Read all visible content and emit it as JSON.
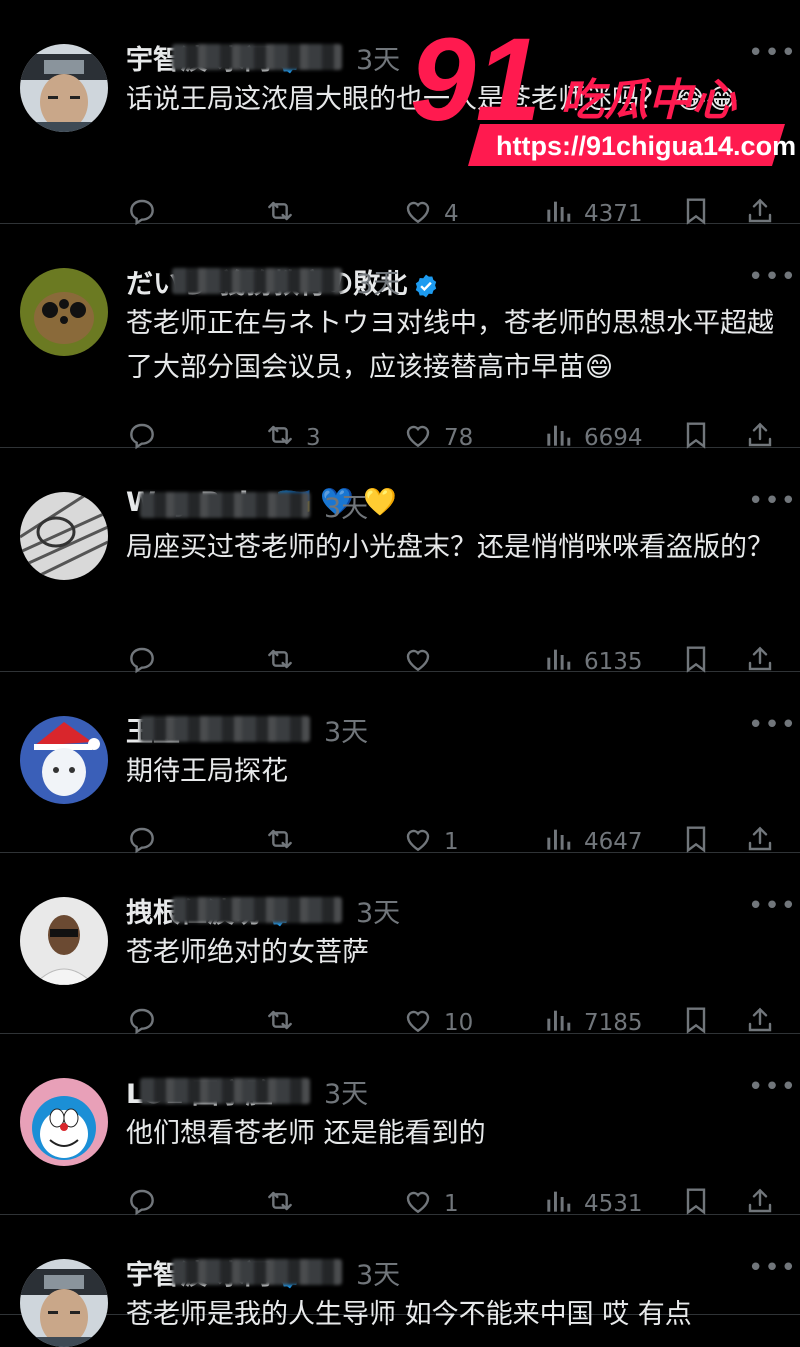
{
  "posts": [
    {
      "name": "宇智波·水门",
      "verified": true,
      "time": "3天",
      "text": "话说王局这浓眉大眼的也一人是苍老师迷吗？\n😂😂",
      "likes": "4",
      "retweets": "",
      "views": "4371",
      "avatar": "ninja"
    },
    {
      "name": "だいち-義務教育の敗北",
      "verified": true,
      "time": "3天",
      "text": "苍老师正在与ネトウヨ对线中，苍老师的思想水平超越了大部分国会议员，应该接替高市早苗😄",
      "likes": "78",
      "retweets": "3",
      "views": "6694",
      "avatar": "spider"
    },
    {
      "name": "Wey Rain 🇺🇦 💙 💛",
      "verified": false,
      "time": "3天",
      "text": "局座买过苍老师的小光盘末？还是悄悄咪咪看盗版的？",
      "likes": "",
      "retweets": "",
      "views": "6135",
      "avatar": "sketch"
    },
    {
      "name": "王玉",
      "verified": false,
      "time": "3天",
      "text": "期待王局探花",
      "likes": "1",
      "retweets": "",
      "views": "4647",
      "avatar": "anime"
    },
    {
      "name": "拽根仁波切",
      "verified": true,
      "time": "3天",
      "text": "苍老师绝对的女菩萨",
      "likes": "10",
      "retweets": "",
      "views": "7185",
      "avatar": "person"
    },
    {
      "name": "LOL 国字脸",
      "verified": false,
      "time": "3天",
      "text": "他们想看苍老师 还是能看到的",
      "likes": "1",
      "retweets": "",
      "views": "4531",
      "avatar": "doraemon"
    },
    {
      "name": "宇智波·水门",
      "verified": true,
      "time": "3天",
      "text": "苍老师是我的人生导师 如今不能来中国 哎 有点",
      "likes": "",
      "retweets": "",
      "views": "",
      "avatar": "ninja"
    }
  ],
  "watermark": {
    "big": "91",
    "brand": "吃瓜中心",
    "url": "https://91chigua14.com"
  },
  "colors": {
    "background": "#000000",
    "text": "#e7e9ea",
    "muted": "#71767b",
    "verified": "#1d9bf0",
    "watermark": "#ff1a4f"
  }
}
